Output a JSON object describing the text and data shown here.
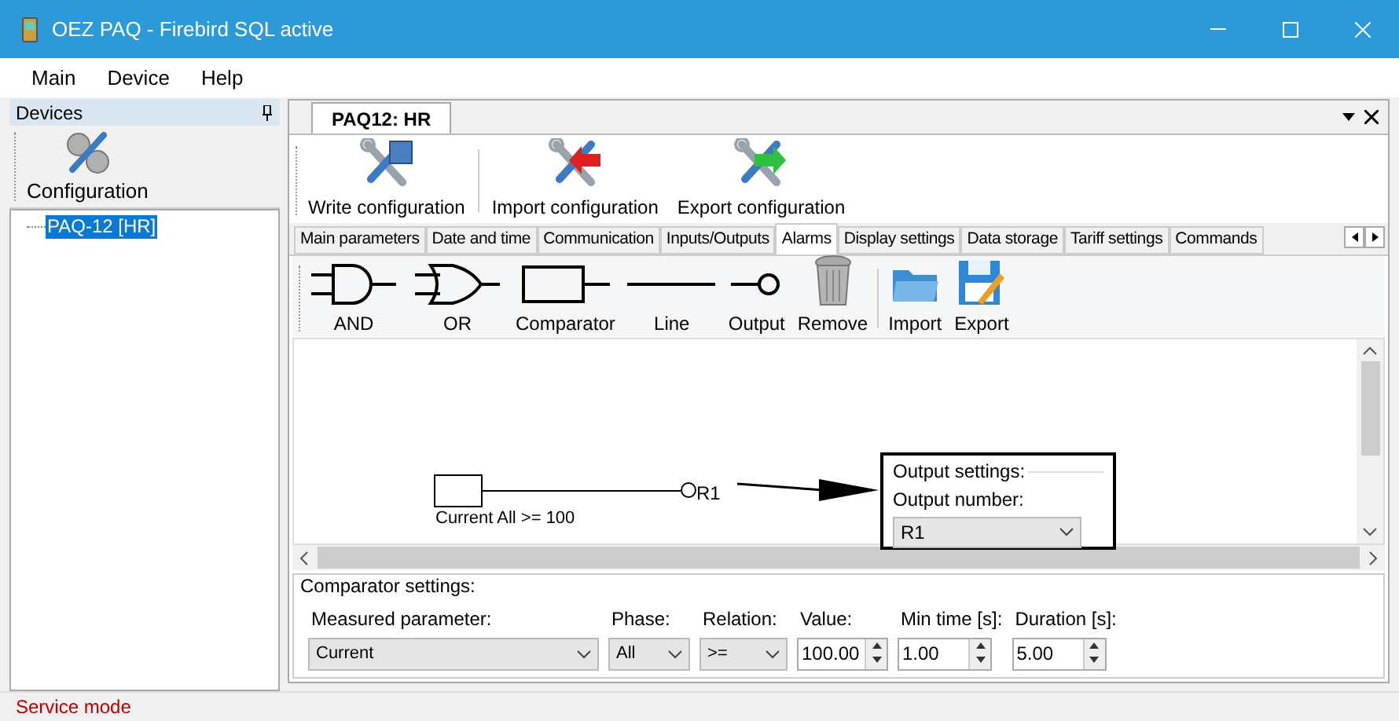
{
  "window": {
    "title": "OEZ PAQ - Firebird SQL active"
  },
  "menu": [
    "Main",
    "Device",
    "Help"
  ],
  "devices_panel": {
    "title": "Devices",
    "toolbar_button": "Configuration",
    "tree": [
      {
        "label": "PAQ-12 [HR]",
        "selected": true
      }
    ]
  },
  "document_tab": {
    "label": "PAQ12: HR",
    "selected": true
  },
  "toolbar": [
    {
      "kind": "write",
      "label": "Write configuration"
    },
    {
      "kind": "import",
      "label": "Import configuration"
    },
    {
      "kind": "export",
      "label": "Export configuration"
    }
  ],
  "tabs": [
    {
      "label": "Main parameters",
      "selected": false
    },
    {
      "label": "Date and time",
      "selected": false
    },
    {
      "label": "Communication",
      "selected": false
    },
    {
      "label": "Inputs/Outputs",
      "selected": false
    },
    {
      "label": "Alarms",
      "selected": true
    },
    {
      "label": "Display settings",
      "selected": false
    },
    {
      "label": "Data storage",
      "selected": false
    },
    {
      "label": "Tariff settings",
      "selected": false
    },
    {
      "label": "Commands",
      "selected": false
    }
  ],
  "alarm_tools": [
    {
      "kind": "and",
      "label": "AND"
    },
    {
      "kind": "or",
      "label": "OR"
    },
    {
      "kind": "comparator",
      "label": "Comparator"
    },
    {
      "kind": "line",
      "label": "Line"
    },
    {
      "kind": "output",
      "label": "Output"
    },
    {
      "kind": "remove",
      "label": "Remove"
    },
    {
      "kind": "import",
      "label": "Import"
    },
    {
      "kind": "export",
      "label": "Export"
    }
  ],
  "canvas": {
    "comparator_label": "Current All >= 100",
    "output_label": "R1",
    "output_settings": {
      "title": "Output settings:",
      "number_label": "Output number:",
      "value": "R1"
    }
  },
  "comparator_settings": {
    "title": "Comparator settings:",
    "fields": [
      {
        "kind": "select",
        "label": "Measured parameter:",
        "value": "Current"
      },
      {
        "kind": "select",
        "label": "Phase:",
        "value": "All"
      },
      {
        "kind": "select",
        "label": "Relation:",
        "value": ">="
      },
      {
        "kind": "spin",
        "label": "Value:",
        "value": "100.00"
      },
      {
        "kind": "spin",
        "label": "Min time [s]:",
        "value": "1.00"
      },
      {
        "kind": "spin",
        "label": "Duration [s]:",
        "value": "5.00"
      }
    ]
  },
  "status_bar": {
    "text": "Service mode"
  }
}
